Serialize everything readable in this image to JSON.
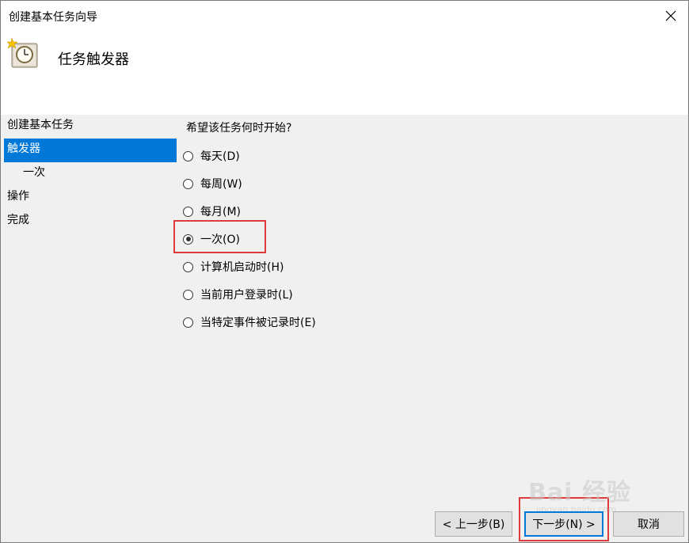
{
  "window": {
    "title": "创建基本任务向导",
    "close_icon": "close-icon"
  },
  "header": {
    "title": "任务触发器",
    "icon": "scheduled-task-clock-icon"
  },
  "sidebar": {
    "items": [
      {
        "label": "创建基本任务",
        "selected": false
      },
      {
        "label": "触发器",
        "selected": true
      },
      {
        "label": "一次",
        "selected": false
      },
      {
        "label": "操作",
        "selected": false
      },
      {
        "label": "完成",
        "selected": false
      }
    ]
  },
  "main": {
    "question": "希望该任务何时开始?",
    "options": [
      {
        "label": "每天(D)",
        "checked": false
      },
      {
        "label": "每周(W)",
        "checked": false
      },
      {
        "label": "每月(M)",
        "checked": false
      },
      {
        "label": "一次(O)",
        "checked": true
      },
      {
        "label": "计算机启动时(H)",
        "checked": false
      },
      {
        "label": "当前用户登录时(L)",
        "checked": false
      },
      {
        "label": "当特定事件被记录时(E)",
        "checked": false
      }
    ]
  },
  "footer": {
    "back_label": "< 上一步(B)",
    "next_label": "下一步(N) >",
    "cancel_label": "取消"
  },
  "watermark": {
    "text": "Bai 经验",
    "sub": "jingyan.baidu.com"
  },
  "colors": {
    "selection": "#0078d7",
    "annotation": "#e03a3a"
  }
}
